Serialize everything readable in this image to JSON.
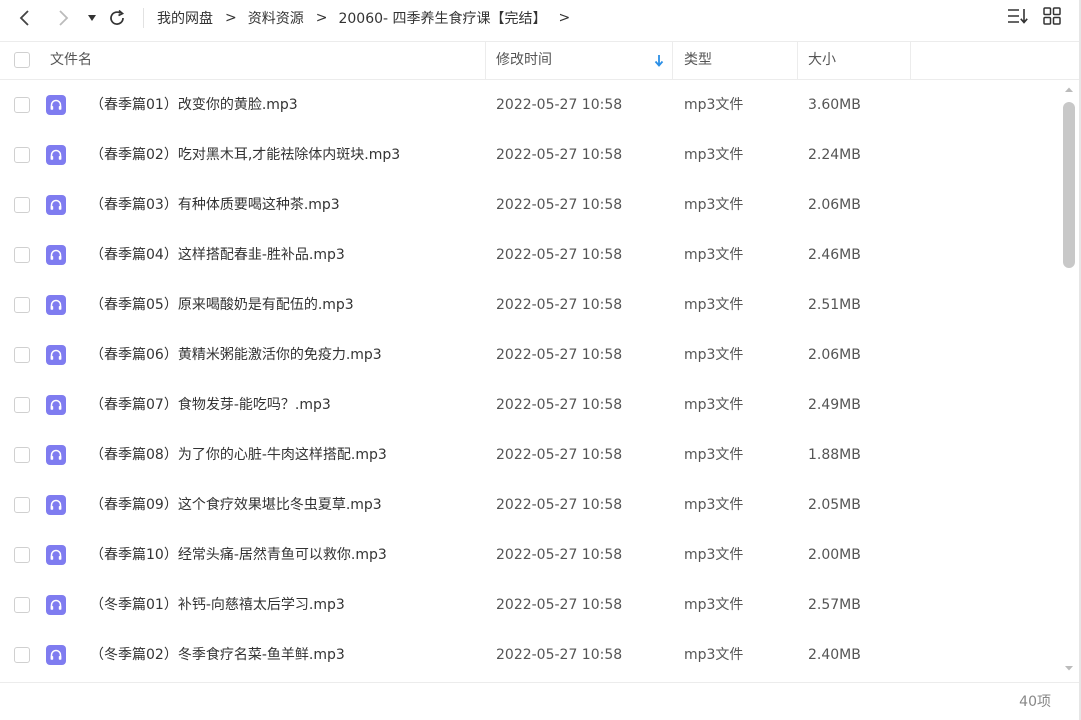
{
  "nav": {
    "back_icon": "chevron-left-icon",
    "forward_icon": "chevron-right-icon",
    "history_icon": "caret-down-icon",
    "refresh_icon": "refresh-icon"
  },
  "breadcrumb": {
    "items": [
      "我的网盘",
      "资料资源",
      "20060- 四季养生食疗课【完结】"
    ],
    "separator": ">"
  },
  "toolbar": {
    "sort_icon": "sort-list-icon",
    "grid_icon": "grid-view-icon"
  },
  "columns": {
    "name": "文件名",
    "modified": "修改时间",
    "type": "类型",
    "size": "大小"
  },
  "files": [
    {
      "name": "（春季篇01）改变你的黄脸.mp3",
      "modified": "2022-05-27 10:58",
      "type": "mp3文件",
      "size": "3.60MB"
    },
    {
      "name": "（春季篇02）吃对黑木耳,才能祛除体内斑块.mp3",
      "modified": "2022-05-27 10:58",
      "type": "mp3文件",
      "size": "2.24MB"
    },
    {
      "name": "（春季篇03）有种体质要喝这种茶.mp3",
      "modified": "2022-05-27 10:58",
      "type": "mp3文件",
      "size": "2.06MB"
    },
    {
      "name": "（春季篇04）这样搭配春韭-胜补品.mp3",
      "modified": "2022-05-27 10:58",
      "type": "mp3文件",
      "size": "2.46MB"
    },
    {
      "name": "（春季篇05）原来喝酸奶是有配伍的.mp3",
      "modified": "2022-05-27 10:58",
      "type": "mp3文件",
      "size": "2.51MB"
    },
    {
      "name": "（春季篇06）黄精米粥能激活你的免疫力.mp3",
      "modified": "2022-05-27 10:58",
      "type": "mp3文件",
      "size": "2.06MB"
    },
    {
      "name": "（春季篇07）食物发芽-能吃吗？.mp3",
      "modified": "2022-05-27 10:58",
      "type": "mp3文件",
      "size": "2.49MB"
    },
    {
      "name": "（春季篇08）为了你的心脏-牛肉这样搭配.mp3",
      "modified": "2022-05-27 10:58",
      "type": "mp3文件",
      "size": "1.88MB"
    },
    {
      "name": "（春季篇09）这个食疗效果堪比冬虫夏草.mp3",
      "modified": "2022-05-27 10:58",
      "type": "mp3文件",
      "size": "2.05MB"
    },
    {
      "name": "（春季篇10）经常头痛-居然青鱼可以救你.mp3",
      "modified": "2022-05-27 10:58",
      "type": "mp3文件",
      "size": "2.00MB"
    },
    {
      "name": "（冬季篇01）补钙-向慈禧太后学习.mp3",
      "modified": "2022-05-27 10:58",
      "type": "mp3文件",
      "size": "2.57MB"
    },
    {
      "name": "（冬季篇02）冬季食疗名菜-鱼羊鲜.mp3",
      "modified": "2022-05-27 10:58",
      "type": "mp3文件",
      "size": "2.40MB"
    }
  ],
  "file_icon": "audio-file-icon",
  "status": {
    "count": "40项"
  },
  "colors": {
    "accent": "#2b8fe6",
    "file_icon_bg": "#7f7cf0"
  }
}
